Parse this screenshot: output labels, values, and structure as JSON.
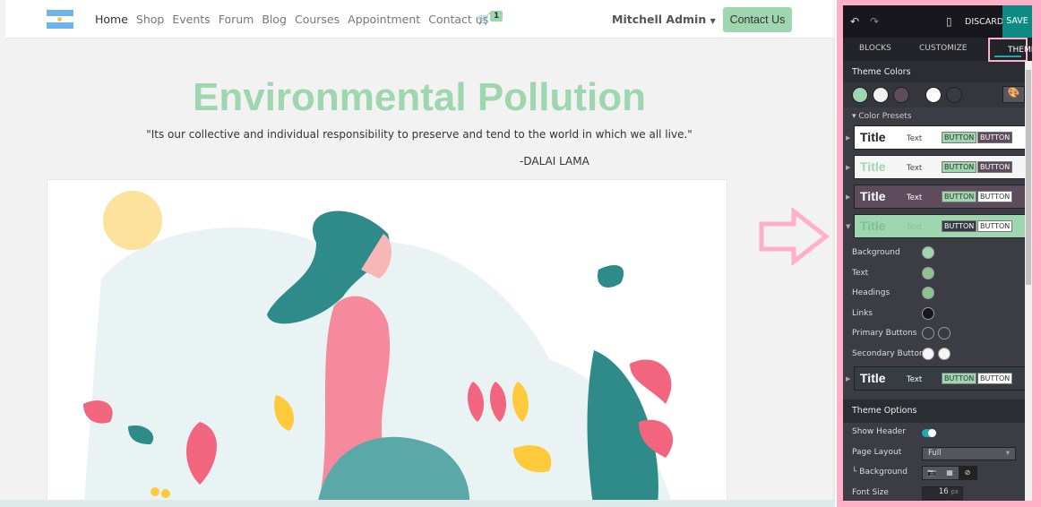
{
  "nav": {
    "items": [
      "Home",
      "Shop",
      "Events",
      "Forum",
      "Blog",
      "Courses",
      "Appointment",
      "Contact us"
    ],
    "active": "Home",
    "cart_count": "1",
    "user": "Mitchell Admin",
    "cta": "Contact Us"
  },
  "hero": {
    "title": "Environmental Pollution",
    "quote": "\"Its our collective and individual responsibility to preserve and tend to the world in which we all live.\"",
    "author": "-DALAI LAMA"
  },
  "editor": {
    "discard": "DISCARD",
    "save": "SAVE",
    "tabs": {
      "blocks": "BLOCKS",
      "customize": "CUSTOMIZE",
      "theme": "THEME"
    },
    "theme_colors_title": "Theme Colors",
    "theme_colors": [
      "#9ed6b0",
      "#f2f2f2",
      "#5e4c5c",
      "#ffffff",
      "#363c42"
    ],
    "color_presets_label": "Color Presets",
    "presets": [
      {
        "title": "Title",
        "text": "Text",
        "btn1": "BUTTON",
        "btn2": "BUTTON",
        "bg": "#ffffff",
        "tc": "#222",
        "xc": "#444",
        "b1bg": "#9ed6b0",
        "b1c": "#333",
        "b2bg": "#5e4c5c",
        "b2c": "#fff"
      },
      {
        "title": "Title",
        "text": "Text",
        "btn1": "BUTTON",
        "btn2": "BUTTON",
        "bg": "#f5f5f5",
        "tc": "#9ed6b0",
        "xc": "#444",
        "b1bg": "#9ed6b0",
        "b1c": "#333",
        "b2bg": "#5e4c5c",
        "b2c": "#fff"
      },
      {
        "title": "Title",
        "text": "Text",
        "btn1": "BUTTON",
        "btn2": "BUTTON",
        "bg": "#5e4c5c",
        "tc": "#fff",
        "xc": "#fff",
        "b1bg": "#9ed6b0",
        "b1c": "#333",
        "b2bg": "#fff",
        "b2c": "#333"
      },
      {
        "title": "Title",
        "text": "Text",
        "btn1": "BUTTON",
        "btn2": "BUTTON",
        "bg": "#9ed6b0",
        "tc": "#7fbf8f",
        "xc": "#86c196",
        "b1bg": "#363c42",
        "b1c": "#fff",
        "b2bg": "#fff",
        "b2c": "#333"
      }
    ],
    "preset_details": [
      {
        "label": "Background",
        "colors": [
          "#9ed6b0"
        ]
      },
      {
        "label": "Text",
        "colors": [
          "#8fc28f"
        ]
      },
      {
        "label": "Headings",
        "colors": [
          "#8fc28f"
        ]
      },
      {
        "label": "Links",
        "colors": [
          "#17171d"
        ]
      },
      {
        "label": "Primary Buttons",
        "colors": [
          "#363c42",
          "#363c42"
        ]
      },
      {
        "label": "Secondary Buttons",
        "colors": [
          "#f5f5f5",
          "#f5f5f5"
        ]
      }
    ],
    "last_preset": {
      "title": "Title",
      "text": "Text",
      "btn1": "BUTTON",
      "btn2": "BUTTON",
      "bg": "#363c42",
      "tc": "#fff",
      "xc": "#fff",
      "b1bg": "#9ed6b0",
      "b1c": "#333",
      "b2bg": "#fff",
      "b2c": "#333"
    },
    "theme_options_title": "Theme Options",
    "options": {
      "show_header": "Show Header",
      "show_header_on": true,
      "page_layout": "Page Layout",
      "page_layout_value": "Full",
      "background": "└ Background",
      "font_size": "Font Size",
      "font_size_value": "16",
      "font_size_unit": "px"
    }
  }
}
